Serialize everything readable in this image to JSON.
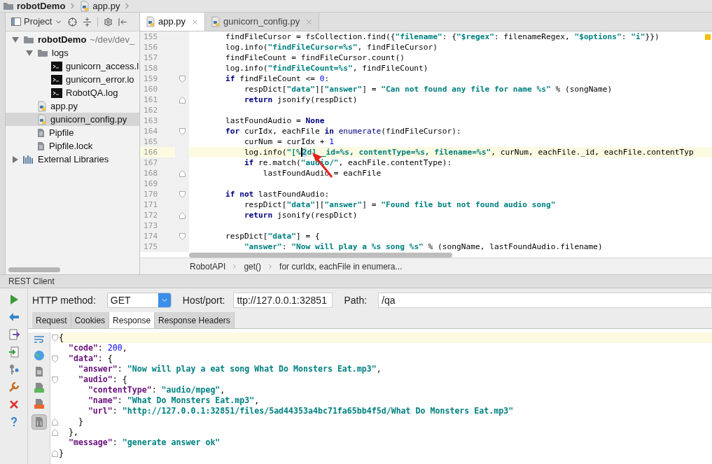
{
  "breadcrumb": [
    {
      "label": "robotDemo",
      "kind": "folder"
    },
    {
      "label": "app.py",
      "kind": "python"
    }
  ],
  "project_panel": {
    "title": "Project",
    "tree": [
      {
        "label": "robotDemo",
        "hint": "~/dev/dev_",
        "kind": "folder",
        "expanded": true,
        "selected": false,
        "children": [
          {
            "label": "logs",
            "kind": "folder",
            "expanded": true,
            "selected": false,
            "children": [
              {
                "label": "gunicorn_access.l",
                "kind": "log",
                "selected": false
              },
              {
                "label": "gunicorn_error.lo",
                "kind": "log",
                "selected": false
              },
              {
                "label": "RobotQA.log",
                "kind": "log",
                "selected": false
              }
            ]
          },
          {
            "label": "app.py",
            "kind": "python",
            "selected": false
          },
          {
            "label": "gunicorn_config.py",
            "kind": "python",
            "selected": true
          },
          {
            "label": "Pipfile",
            "kind": "file",
            "selected": false
          },
          {
            "label": "Pipfile.lock",
            "kind": "file",
            "selected": false
          }
        ]
      },
      {
        "label": "External Libraries",
        "kind": "library",
        "expanded": false,
        "selected": false
      }
    ]
  },
  "editor_tabs": [
    {
      "label": "app.py",
      "selected": true
    },
    {
      "label": "gunicorn_config.py",
      "selected": false
    }
  ],
  "code_lines": [
    {
      "number": "155",
      "current": false,
      "fold_start": false,
      "fold_end": false,
      "tokens": [
        {
          "kind": "plain",
          "text": "    findFileCursor = fsCollection.find({"
        },
        {
          "kind": "string",
          "text": "\"filename\""
        },
        {
          "kind": "plain",
          "text": ": {"
        },
        {
          "kind": "string",
          "text": "\"$regex\""
        },
        {
          "kind": "plain",
          "text": ": filenameRegex, "
        },
        {
          "kind": "string",
          "text": "\"$options\""
        },
        {
          "kind": "plain",
          "text": ": "
        },
        {
          "kind": "string",
          "text": "\"i\""
        },
        {
          "kind": "plain",
          "text": "}})"
        }
      ]
    },
    {
      "number": "156",
      "current": false,
      "fold_start": false,
      "fold_end": false,
      "tokens": [
        {
          "kind": "plain",
          "text": "    log.info("
        },
        {
          "kind": "string",
          "text": "\"findFileCursor=%s\""
        },
        {
          "kind": "plain",
          "text": ", findFileCursor)"
        }
      ]
    },
    {
      "number": "157",
      "current": false,
      "fold_start": false,
      "fold_end": false,
      "tokens": [
        {
          "kind": "plain",
          "text": "    findFileCount = findFileCursor.count()"
        }
      ]
    },
    {
      "number": "158",
      "current": false,
      "fold_start": false,
      "fold_end": false,
      "tokens": [
        {
          "kind": "plain",
          "text": "    log.info("
        },
        {
          "kind": "string",
          "text": "\"findFileCount=%s\""
        },
        {
          "kind": "plain",
          "text": ", findFileCount)"
        }
      ]
    },
    {
      "number": "159",
      "current": false,
      "fold_start": true,
      "fold_end": false,
      "tokens": [
        {
          "kind": "keyword",
          "text": "    if"
        },
        {
          "kind": "plain",
          "text": " findFileCount <= "
        },
        {
          "kind": "number",
          "text": "0"
        },
        {
          "kind": "plain",
          "text": ":"
        }
      ]
    },
    {
      "number": "160",
      "current": false,
      "fold_start": false,
      "fold_end": false,
      "tokens": [
        {
          "kind": "plain",
          "text": "        respDict["
        },
        {
          "kind": "string",
          "text": "\"data\""
        },
        {
          "kind": "plain",
          "text": "]["
        },
        {
          "kind": "string",
          "text": "\"answer\""
        },
        {
          "kind": "plain",
          "text": "] = "
        },
        {
          "kind": "string",
          "text": "\"Can not found any file for name %s\""
        },
        {
          "kind": "plain",
          "text": " % (songName)"
        }
      ]
    },
    {
      "number": "161",
      "current": false,
      "fold_start": false,
      "fold_end": true,
      "tokens": [
        {
          "kind": "keyword",
          "text": "        return"
        },
        {
          "kind": "plain",
          "text": " jsonify(respDict)"
        }
      ]
    },
    {
      "number": "162",
      "current": false,
      "fold_start": false,
      "fold_end": false
    },
    {
      "number": "163",
      "current": false,
      "fold_start": false,
      "fold_end": false,
      "tokens": [
        {
          "kind": "plain",
          "text": "    lastFoundAudio = "
        },
        {
          "kind": "keyword",
          "text": "None"
        }
      ]
    },
    {
      "number": "164",
      "current": false,
      "fold_start": true,
      "fold_end": false,
      "tokens": [
        {
          "kind": "keyword",
          "text": "    for"
        },
        {
          "kind": "plain",
          "text": " curIdx, eachFile "
        },
        {
          "kind": "keyword",
          "text": "in"
        },
        {
          "kind": "builtin",
          "text": " enumerate"
        },
        {
          "kind": "plain",
          "text": "(findFileCursor):"
        }
      ]
    },
    {
      "number": "165",
      "current": false,
      "fold_start": false,
      "fold_end": false,
      "tokens": [
        {
          "kind": "plain",
          "text": "        curNum = curIdx + "
        },
        {
          "kind": "number",
          "text": "1"
        }
      ]
    },
    {
      "number": "166",
      "current": true,
      "fold_start": false,
      "fold_end": false,
      "tokens": [
        {
          "kind": "plain",
          "text": "        log.info("
        },
        {
          "kind": "string",
          "text": "\"[%"
        },
        {
          "kind": "string",
          "text": "2",
          "caret": true
        },
        {
          "kind": "string",
          "text": "d] _id=%s, contentType=%s, filename=%s\""
        },
        {
          "kind": "plain",
          "text": ", curNum, eachFile._id, eachFile.contentTyp"
        }
      ]
    },
    {
      "number": "167",
      "current": false,
      "fold_start": false,
      "fold_end": false,
      "tokens": [
        {
          "kind": "keyword",
          "text": "        if"
        },
        {
          "kind": "plain",
          "text": " re.match("
        },
        {
          "kind": "string",
          "text": "\"audio/\""
        },
        {
          "kind": "plain",
          "text": ", eachFile.contentType):"
        }
      ]
    },
    {
      "number": "168",
      "current": false,
      "fold_start": false,
      "fold_end": true,
      "tokens": [
        {
          "kind": "plain",
          "text": "            lastFoundAudio = eachFile"
        }
      ]
    },
    {
      "number": "169",
      "current": false,
      "fold_start": false,
      "fold_end": false
    },
    {
      "number": "170",
      "current": false,
      "fold_start": true,
      "fold_end": false,
      "tokens": [
        {
          "kind": "keyword",
          "text": "    if not"
        },
        {
          "kind": "plain",
          "text": " lastFoundAudio:"
        }
      ]
    },
    {
      "number": "171",
      "current": false,
      "fold_start": false,
      "fold_end": false,
      "tokens": [
        {
          "kind": "plain",
          "text": "        respDict["
        },
        {
          "kind": "string",
          "text": "\"data\""
        },
        {
          "kind": "plain",
          "text": "]["
        },
        {
          "kind": "string",
          "text": "\"answer\""
        },
        {
          "kind": "plain",
          "text": "] = "
        },
        {
          "kind": "string",
          "text": "\"Found file but not found audio song\""
        }
      ]
    },
    {
      "number": "172",
      "current": false,
      "fold_start": false,
      "fold_end": true,
      "tokens": [
        {
          "kind": "keyword",
          "text": "        return"
        },
        {
          "kind": "plain",
          "text": " jsonify(respDict)"
        }
      ]
    },
    {
      "number": "173",
      "current": false,
      "fold_start": false,
      "fold_end": false
    },
    {
      "number": "174",
      "current": false,
      "fold_start": true,
      "fold_end": false,
      "tokens": [
        {
          "kind": "plain",
          "text": "    respDict["
        },
        {
          "kind": "string",
          "text": "\"data\""
        },
        {
          "kind": "plain",
          "text": "] = {"
        }
      ]
    },
    {
      "number": "175",
      "current": false,
      "fold_start": false,
      "fold_end": false,
      "tokens": [
        {
          "kind": "string",
          "text": "        \"answer\""
        },
        {
          "kind": "plain",
          "text": ": "
        },
        {
          "kind": "string",
          "text": "\"Now will play a %s song %s\""
        },
        {
          "kind": "plain",
          "text": " % (songName, lastFoundAudio.filename)"
        }
      ]
    }
  ],
  "editor_breadcrumb": [
    "RobotAPI",
    "get()",
    "for curIdx, eachFile in enumera..."
  ],
  "rest_client": {
    "title": "REST Client",
    "method_label": "HTTP method:",
    "method": "GET",
    "host_label": "Host/port:",
    "host": "ttp://127.0.0.1:32851",
    "path_label": "Path:",
    "path": "/qa",
    "tabs": [
      {
        "label": "Request",
        "selected": false
      },
      {
        "label": "Cookies",
        "selected": false
      },
      {
        "label": "Response",
        "selected": true
      },
      {
        "label": "Response Headers",
        "selected": false
      }
    ],
    "response_lines": [
      {
        "fold_start": true,
        "fold_end": false,
        "current": true,
        "tokens": [
          {
            "kind": "plain",
            "text": "{"
          }
        ]
      },
      {
        "fold_start": false,
        "fold_end": false,
        "current": false,
        "tokens": [
          {
            "kind": "key",
            "text": "  \"code\""
          },
          {
            "kind": "plain",
            "text": ": "
          },
          {
            "kind": "number",
            "text": "200"
          },
          {
            "kind": "plain",
            "text": ","
          }
        ]
      },
      {
        "fold_start": true,
        "fold_end": false,
        "current": false,
        "tokens": [
          {
            "kind": "key",
            "text": "  \"data\""
          },
          {
            "kind": "plain",
            "text": ": {"
          }
        ]
      },
      {
        "fold_start": false,
        "fold_end": false,
        "current": false,
        "tokens": [
          {
            "kind": "key",
            "text": "    \"answer\""
          },
          {
            "kind": "plain",
            "text": ": "
          },
          {
            "kind": "string",
            "text": "\"Now will play a eat song What Do Monsters Eat.mp3\""
          },
          {
            "kind": "plain",
            "text": ","
          }
        ]
      },
      {
        "fold_start": true,
        "fold_end": false,
        "current": false,
        "tokens": [
          {
            "kind": "key",
            "text": "    \"audio\""
          },
          {
            "kind": "plain",
            "text": ": {"
          }
        ]
      },
      {
        "fold_start": false,
        "fold_end": false,
        "current": false,
        "tokens": [
          {
            "kind": "key",
            "text": "      \"contentType\""
          },
          {
            "kind": "plain",
            "text": ": "
          },
          {
            "kind": "string",
            "text": "\"audio/mpeg\""
          },
          {
            "kind": "plain",
            "text": ","
          }
        ]
      },
      {
        "fold_start": false,
        "fold_end": false,
        "current": false,
        "tokens": [
          {
            "kind": "key",
            "text": "      \"name\""
          },
          {
            "kind": "plain",
            "text": ": "
          },
          {
            "kind": "string",
            "text": "\"What Do Monsters Eat.mp3\""
          },
          {
            "kind": "plain",
            "text": ","
          }
        ]
      },
      {
        "fold_start": false,
        "fold_end": false,
        "current": false,
        "tokens": [
          {
            "kind": "key",
            "text": "      \"url\""
          },
          {
            "kind": "plain",
            "text": ": "
          },
          {
            "kind": "string",
            "text": "\"http://127.0.0.1:32851/files/5ad44353a4bc71fa65bb4f5d/What Do Monsters Eat.mp3\""
          }
        ]
      },
      {
        "fold_start": false,
        "fold_end": true,
        "current": false,
        "tokens": [
          {
            "kind": "plain",
            "text": "    }"
          }
        ]
      },
      {
        "fold_start": false,
        "fold_end": true,
        "current": false,
        "tokens": [
          {
            "kind": "plain",
            "text": "  },"
          }
        ]
      },
      {
        "fold_start": false,
        "fold_end": false,
        "current": false,
        "tokens": [
          {
            "kind": "key",
            "text": "  \"message\""
          },
          {
            "kind": "plain",
            "text": ": "
          },
          {
            "kind": "string",
            "text": "\"generate answer ok\""
          }
        ]
      },
      {
        "fold_start": false,
        "fold_end": true,
        "current": false,
        "tokens": [
          {
            "kind": "plain",
            "text": "}"
          }
        ]
      }
    ]
  }
}
